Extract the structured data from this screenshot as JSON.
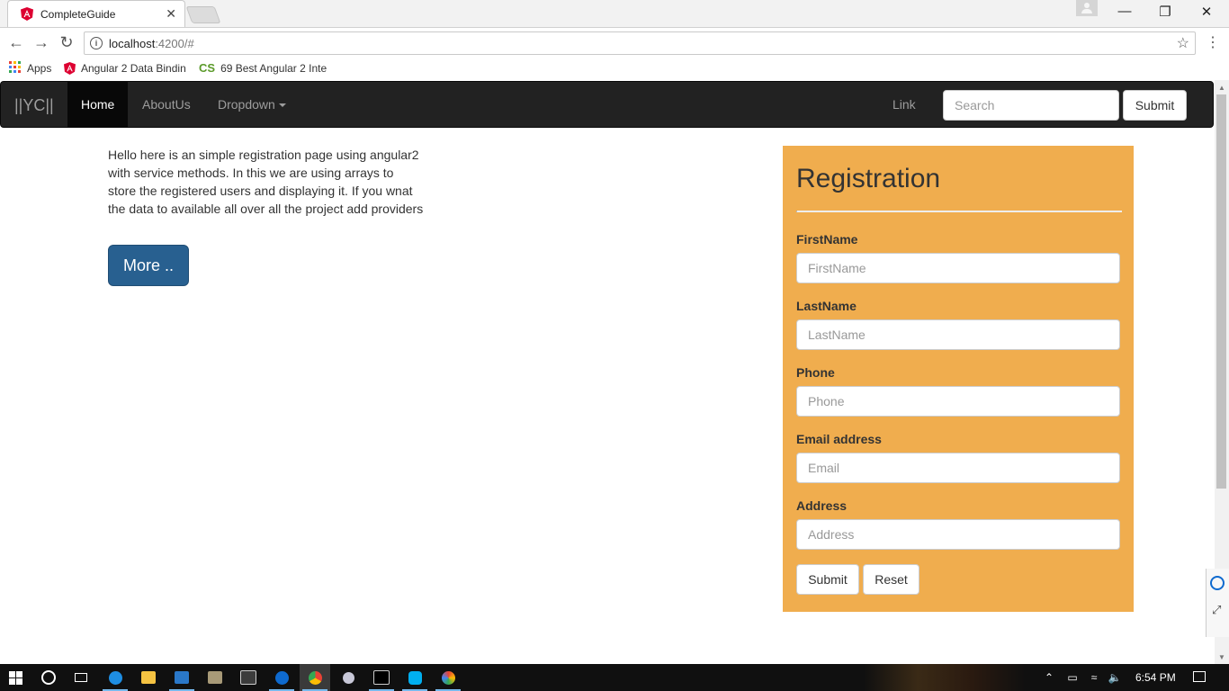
{
  "browser": {
    "tab_title": "CompleteGuide",
    "tab_close": "✕",
    "url_host": "localhost",
    "url_rest": ":4200/#",
    "bookmarks": {
      "apps": "Apps",
      "item1": "Angular 2 Data Bindin",
      "item2": "69 Best Angular 2 Inte"
    },
    "window_controls": {
      "minimize": "—",
      "restore": "❐",
      "close": "✕"
    }
  },
  "navbar": {
    "brand": "||YC||",
    "items": [
      {
        "label": "Home",
        "active": true
      },
      {
        "label": "AboutUs",
        "active": false
      },
      {
        "label": "Dropdown",
        "active": false
      }
    ],
    "link": "Link",
    "search_placeholder": "Search",
    "submit": "Submit"
  },
  "intro": {
    "text": "Hello here is an simple registration page using angular2 with service methods. In this we are using arrays to store the registered users and displaying it. If you wnat the data to available all over all the project add providers",
    "button": "More .."
  },
  "registration": {
    "title": "Registration",
    "fields": [
      {
        "label": "FirstName",
        "placeholder": "FirstName"
      },
      {
        "label": "LastName",
        "placeholder": "LastName"
      },
      {
        "label": "Phone",
        "placeholder": "Phone"
      },
      {
        "label": "Email address",
        "placeholder": "Email"
      },
      {
        "label": "Address",
        "placeholder": "Address"
      }
    ],
    "submit": "Submit",
    "reset": "Reset",
    "panel_color": "#f0ad4e"
  },
  "taskbar": {
    "clock": "6:54 PM",
    "icons": [
      "windows-start-icon",
      "cortana-icon",
      "task-view-icon",
      "edge-icon",
      "file-explorer-icon",
      "visual-studio-code-icon",
      "app-icon",
      "terminal-icon",
      "teamviewer-icon",
      "chrome-icon",
      "app-icon",
      "cmd-icon",
      "skype-icon",
      "paint-icon"
    ]
  }
}
